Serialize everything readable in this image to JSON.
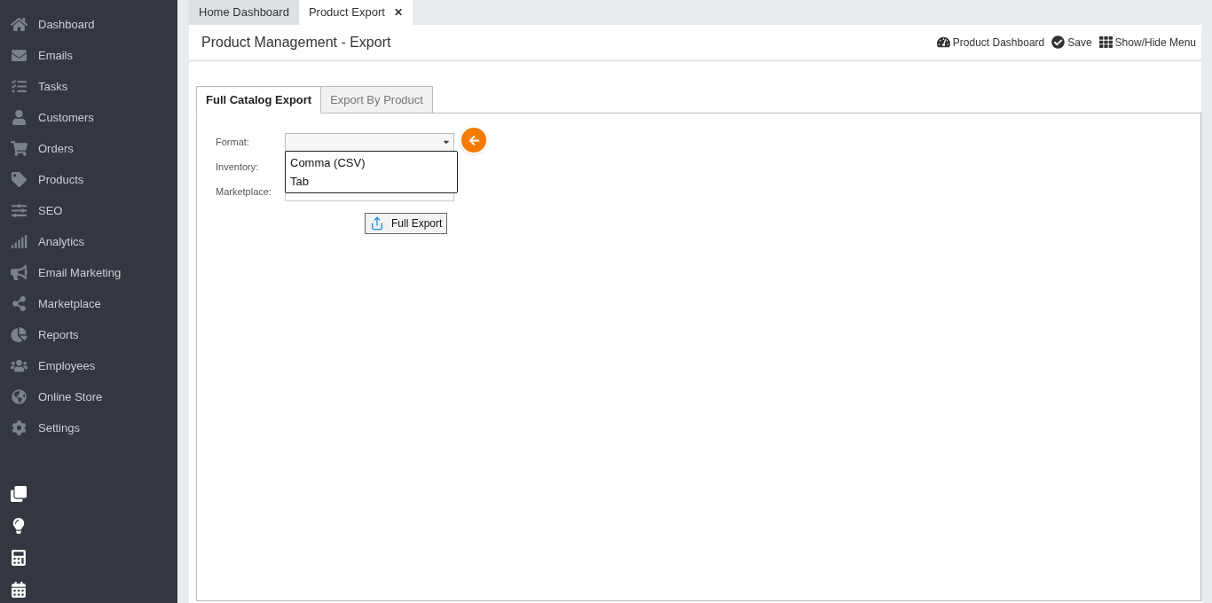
{
  "sidebar": {
    "items": [
      {
        "label": "Dashboard"
      },
      {
        "label": "Emails"
      },
      {
        "label": "Tasks"
      },
      {
        "label": "Customers"
      },
      {
        "label": "Orders"
      },
      {
        "label": "Products"
      },
      {
        "label": "SEO"
      },
      {
        "label": "Analytics"
      },
      {
        "label": "Email Marketing"
      },
      {
        "label": "Marketplace"
      },
      {
        "label": "Reports"
      },
      {
        "label": "Employees"
      },
      {
        "label": "Online Store"
      },
      {
        "label": "Settings"
      }
    ]
  },
  "tabs": [
    {
      "label": "Home Dashboard",
      "selected": false,
      "closable": false
    },
    {
      "label": "Product Export",
      "selected": true,
      "closable": true
    }
  ],
  "close_glyph": "✕",
  "page": {
    "title": "Product Management - Export",
    "actions": [
      "Product Dashboard",
      "Save",
      "Show/Hide Menu"
    ]
  },
  "inner_tabs": [
    {
      "label": "Full Catalog Export",
      "selected": true
    },
    {
      "label": "Export By Product",
      "selected": false
    }
  ],
  "form": {
    "fields": [
      {
        "label": "Format:"
      },
      {
        "label": "Inventory:"
      },
      {
        "label": "Marketplace:"
      }
    ],
    "dropdown": {
      "expanded": true,
      "options": [
        "Comma (CSV)",
        "Tab"
      ]
    },
    "button": "Full Export"
  }
}
